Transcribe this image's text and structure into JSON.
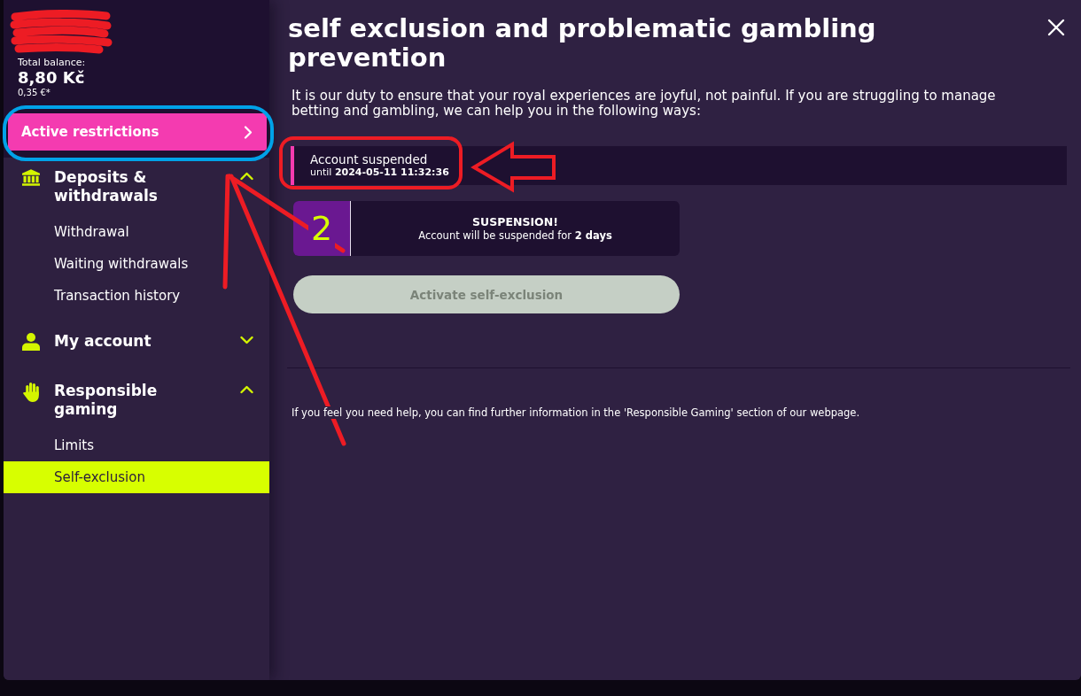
{
  "account": {
    "balance_label": "Total balance:",
    "balance": "8,80 Kč",
    "balance_secondary": "0,35 €*"
  },
  "restrictions_button": {
    "label": "Active restrictions"
  },
  "sidebar": {
    "groups": [
      {
        "label": "Deposits & withdrawals",
        "expanded": true,
        "items": [
          {
            "label": "Withdrawal",
            "selected": false
          },
          {
            "label": "Waiting withdrawals",
            "selected": false
          },
          {
            "label": "Transaction history",
            "selected": false
          }
        ]
      },
      {
        "label": "My account",
        "expanded": false
      },
      {
        "label": "Responsible gaming",
        "expanded": true,
        "items": [
          {
            "label": "Limits",
            "selected": false
          },
          {
            "label": "Self-exclusion",
            "selected": true
          }
        ]
      }
    ]
  },
  "title": "self exclusion and problematic gambling prevention",
  "intro": "It is our duty to ensure that your royal experiences are joyful, not painful. If you are struggling to manage betting and gambling, we can help you in the following ways:",
  "status": {
    "label": "Account suspended",
    "detail": "until **2024-05-11 11:32:36**"
  },
  "suspension_card": {
    "count": "2",
    "heading": "SUSPENSION!",
    "text": "Account will be suspended for **2 days**"
  },
  "activate_button": {
    "label": "Activate self-exclusion",
    "disabled": true
  },
  "footer_note": "If you feel you need help, you can find further information in the 'Responsible Gaming' section of our webpage."
}
